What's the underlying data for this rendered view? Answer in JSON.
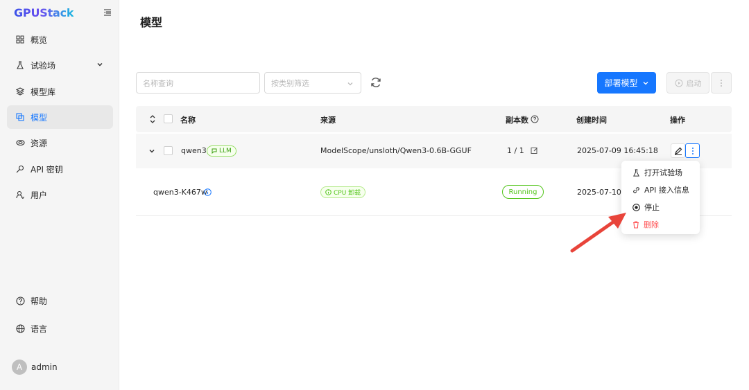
{
  "app": {
    "logo": "GPUStack"
  },
  "sidebar": {
    "items": [
      {
        "label": "概览",
        "icon": "dashboard-icon"
      },
      {
        "label": "试验场",
        "icon": "flask-icon"
      },
      {
        "label": "模型库",
        "icon": "layers-icon"
      },
      {
        "label": "模型",
        "icon": "model-icon",
        "active": true
      },
      {
        "label": "资源",
        "icon": "cloud-icon"
      },
      {
        "label": "API 密钥",
        "icon": "key-icon"
      },
      {
        "label": "用户",
        "icon": "users-icon"
      }
    ],
    "help": "帮助",
    "language": "语言",
    "user": {
      "avatar_letter": "A",
      "name": "admin"
    }
  },
  "page": {
    "title": "模型"
  },
  "filters": {
    "name_placeholder": "名称查询",
    "category_placeholder": "按类别筛选"
  },
  "toolbar": {
    "deploy_label": "部署模型",
    "start_label": "启动"
  },
  "table": {
    "headers": {
      "name": "名称",
      "source": "来源",
      "replicas": "副本数",
      "created": "创建时间",
      "actions": "操作"
    },
    "rows": [
      {
        "name": "qwen3",
        "tag": "LLM",
        "source": "ModelScope/unsloth/Qwen3-0.6B-GGUF",
        "replicas": "1 / 1",
        "created": "2025-07-09 16:45:18"
      }
    ],
    "instances": [
      {
        "name": "qwen3-K467w",
        "tag": "CPU 卸载",
        "status": "Running",
        "created": "2025-07-10 1"
      }
    ]
  },
  "dropdown": {
    "items": [
      {
        "label": "打开试验场",
        "icon": "flask-icon"
      },
      {
        "label": "API 接入信息",
        "icon": "link-icon"
      },
      {
        "label": "停止",
        "icon": "stop-icon"
      },
      {
        "label": "删除",
        "icon": "trash-icon",
        "danger": true
      }
    ]
  },
  "colors": {
    "primary": "#1677ff",
    "success": "#52c41a",
    "danger": "#ff4d4f",
    "annotation": "#e8443a"
  }
}
